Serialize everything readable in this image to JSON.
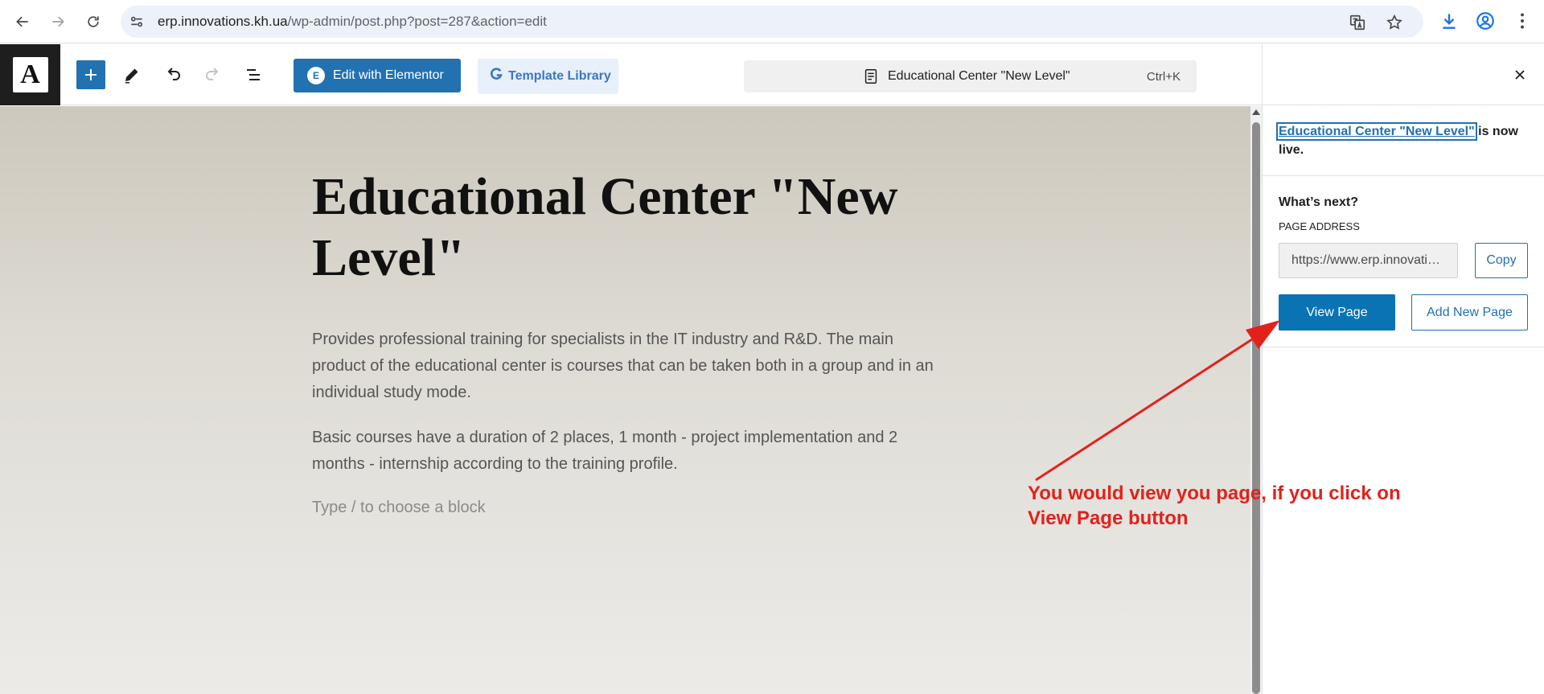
{
  "browser": {
    "url_host": "erp.innovations.kh.ua",
    "url_path": "/wp-admin/post.php?post=287&action=edit",
    "icons": [
      "back-icon",
      "forward-icon",
      "reload-icon",
      "site-settings-icon",
      "translate-icon",
      "star-icon",
      "download-icon",
      "profile-icon",
      "menu-icon"
    ]
  },
  "editor_toolbar": {
    "logo_letter": "A",
    "elementor_badge": "E",
    "elementor_label": "Edit with Elementor",
    "template_label": "Template Library",
    "document_title": "Educational Center \"New Level\"",
    "shortcut": "Ctrl+K"
  },
  "canvas": {
    "title": "Educational Center \"New Level\"",
    "paragraph_1": "Provides professional training for specialists in the IT industry and R&D. The main product of the educational center is courses that can be taken both in a group and in an individual study mode.",
    "paragraph_2": "Basic courses have a duration of 2 places, 1 month - project implementation and 2 months - internship according to the training profile.",
    "placeholder": "Type / to choose a block"
  },
  "panel": {
    "live_link": "Educational Center \"New Level\"",
    "live_suffix": " is now live.",
    "whats_next": "What’s next?",
    "page_address_label": "PAGE ADDRESS",
    "page_address_value": "https://www.erp.innovations.kh.ua/educational-center-new-level/",
    "copy_label": "Copy",
    "view_page_label": "View Page",
    "add_new_page_label": "Add New Page"
  },
  "annotation": {
    "text": "You would view you page, if you click on View Page button",
    "color": "#e3211b"
  },
  "colors": {
    "wp_blue": "#2271b1",
    "primary_button": "#0a73b3"
  }
}
